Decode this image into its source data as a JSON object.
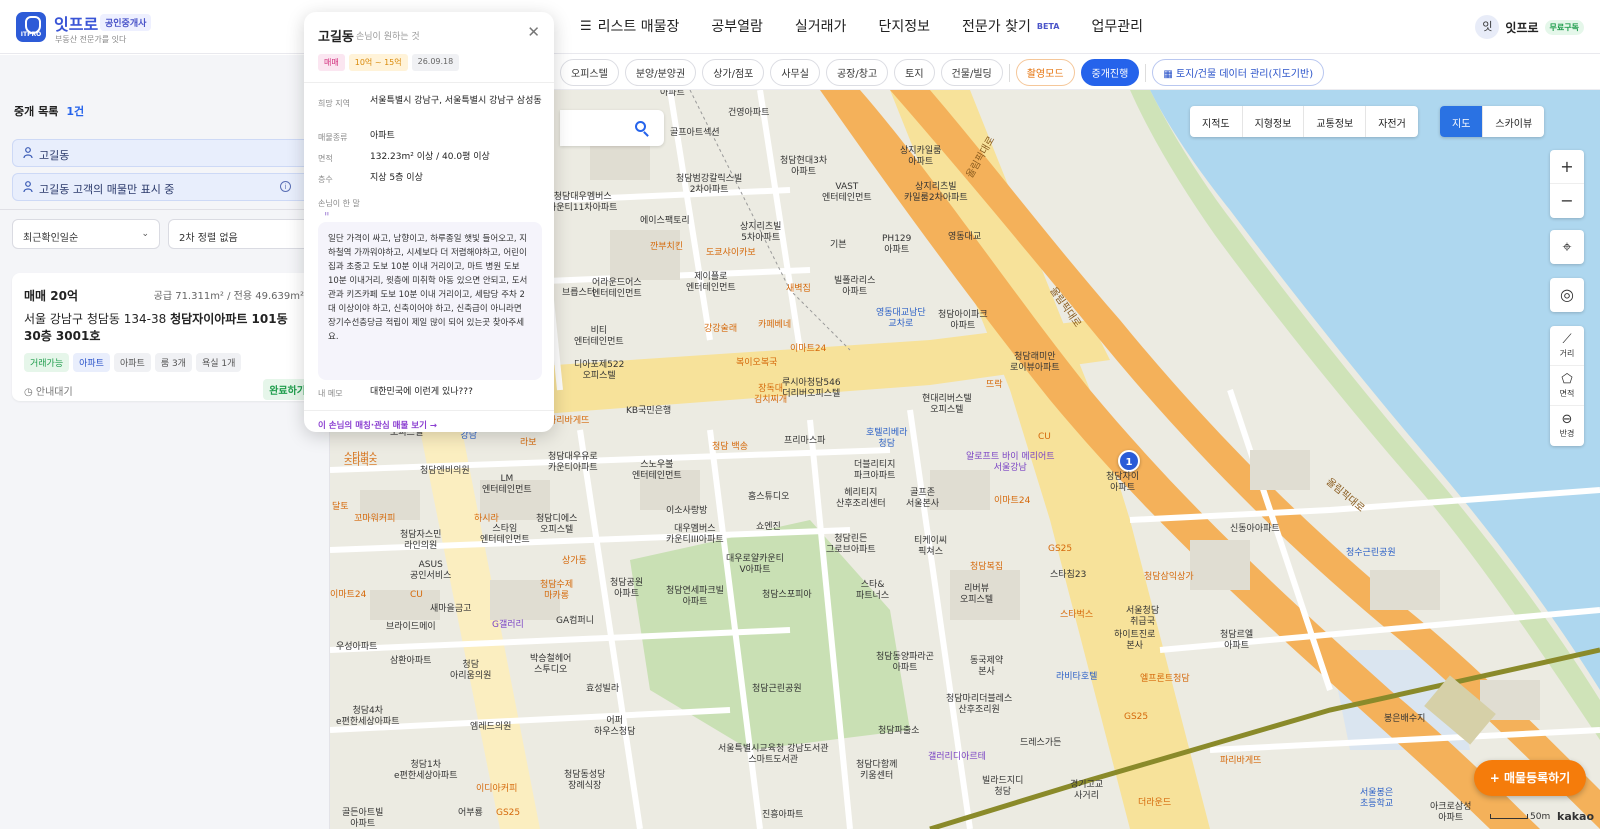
{
  "header": {
    "logo_text": "ITPRO",
    "brand": "잇프로",
    "brand_badge": "공인중개사",
    "tagline": "부동산 전문가를 잇다",
    "nav": [
      {
        "label": "리스트 매물장"
      },
      {
        "label": "공부열람"
      },
      {
        "label": "실거래가"
      },
      {
        "label": "단지정보"
      },
      {
        "label": "전문가 찾기",
        "badge": "BETA"
      },
      {
        "label": "업무관리"
      }
    ],
    "user_avatar": "잇",
    "user_name": "잇프로",
    "plan": "무료구독"
  },
  "filters": {
    "chips": [
      "오피스텔",
      "분양/분양권",
      "상가/점포",
      "사무실",
      "공장/창고",
      "토지",
      "건물/빌딩"
    ],
    "mode_chip": "촬영모드",
    "active_chip": "중개진행",
    "data_chip": "토지/건물 데이터 관리(지도기반)"
  },
  "left_panel": {
    "title": "중개 목록",
    "count": "1건",
    "search_value": "고길동",
    "filter_notice": "고길동 고객의 매물만 표시 중",
    "sort_primary": "최근확인일순",
    "sort_secondary": "2차 정렬 없음",
    "listing": {
      "price": "매매 20억",
      "area": "공급 71.311m² / 전용 49.639m²",
      "address_prefix": "서울 강남구 청담동 134-38 ",
      "address_bold": "청담자이아파트 101동 30층 3001호",
      "tags": [
        "거래가능",
        "아파트",
        "아파트",
        "룸 3개",
        "욕실 1개"
      ],
      "status": "안내대기",
      "done_label": "완료하기"
    }
  },
  "popup": {
    "name": "고길동",
    "subtitle": "손님이 원하는 것",
    "tags": [
      "매매",
      "10억 ~ 15억",
      "26.09.18"
    ],
    "rows": [
      {
        "label": "희망 지역",
        "value": "서울특별시 강남구, 서울특별시 강남구 삼성동"
      },
      {
        "label": "매물종류",
        "value": "아파트"
      },
      {
        "label": "면적",
        "value": "132.23m² 이상 / 40.0평 이상"
      },
      {
        "label": "층수",
        "value": "지상 5층 이상"
      }
    ],
    "note_label": "손님이 한 말",
    "note": "일단 가격이 싸고, 남향이고, 하루종일 햇빛 들어오고, 지하철역 가까워야하고, 시세보다 더 저렴해야하고, 어린이집과 초중고 도보 10분 이내 거리이고, 마트 병원 도보 10분 이내거리, 윗층에 미취학 아동 있으면 안되고, 도서관과 키즈카페 도보 10분 이내 거리이고, 세탐당 주차 2대 이상이야 하고, 신축이어야 하고, 신축급이 아니라면 장기수선충당금 적립이 제일 많이 되어 있는곳 찾아주세요.",
    "memo_label": "내 메모",
    "memo": "대한민국에 이런게 있나???",
    "link": "이 손님의 매칭·관심 매물 보기 →"
  },
  "map": {
    "layer_buttons": [
      "지적도",
      "지형정보",
      "교통정보",
      "자전거"
    ],
    "view_buttons": [
      "지도",
      "스카이뷰"
    ],
    "active_view": "지도",
    "zoom_in": "+",
    "zoom_out": "−",
    "tools": [
      "거리",
      "면적",
      "반경"
    ],
    "marker_count": "1",
    "marker_label": "청담자이\n아파트",
    "register_button": "+ 매물등록하기",
    "scale": "50m",
    "attribution": "kakao",
    "labels": [
      {
        "t": "아파트"
      },
      {
        "t": "건영아파트"
      },
      {
        "t": "골프아트섹션"
      },
      {
        "t": "청담현대3차\n아파트"
      },
      {
        "t": "상지카일룸\n아파트"
      },
      {
        "t": "청담대우멤버스\n카운티11차아파트"
      },
      {
        "t": "청담범강칼릭스빌\n2차아파트"
      },
      {
        "t": "VAST\n엔터테인먼트"
      },
      {
        "t": "상지리츠빌\n카일룸2차아파트"
      },
      {
        "t": "에이스팩토리"
      },
      {
        "t": "상지리츠빌\n5차아파트"
      },
      {
        "t": "깐부치킨"
      },
      {
        "t": "도쿄샤이카보"
      },
      {
        "t": "기븐"
      },
      {
        "t": "PH129\n아파트"
      },
      {
        "t": "제이플로\n엔터테인먼트"
      },
      {
        "t": "빌폴라리스\n아파트"
      },
      {
        "t": "새벽집"
      },
      {
        "t": "어라운드어스\n엔터테인먼트"
      },
      {
        "t": "브릅스터"
      },
      {
        "t": "비티\n엔터테인먼트"
      },
      {
        "t": "강강술래"
      },
      {
        "t": "카페베네"
      },
      {
        "t": "청담아이파크\n아파트"
      },
      {
        "t": "영동대교남단\n교차로"
      },
      {
        "t": "디아포제522\n오피스텔"
      },
      {
        "t": "복이오복국"
      },
      {
        "t": "이마트24"
      },
      {
        "t": "청담래미안\n로이뷰아파트"
      },
      {
        "t": "루시아청담546\n더리버오피스텔"
      },
      {
        "t": "장독대\n김치찌개"
      },
      {
        "t": "현대리버스텔\n오피스텔"
      },
      {
        "t": "뜨락"
      },
      {
        "t": "KB국민은행"
      },
      {
        "t": "파리바게뜨"
      },
      {
        "t": "프리마스파"
      },
      {
        "t": "청담 백송"
      },
      {
        "t": "호텔리베라\n청담"
      },
      {
        "t": "알로프트 바이 메리어트\n서울강남"
      },
      {
        "t": "CU"
      },
      {
        "t": "청담대우유로\n카운티아파트"
      },
      {
        "t": "스노우볼\n엔터테인먼트"
      },
      {
        "t": "청담엔비의원"
      },
      {
        "t": "LM\n엔터테인먼트"
      },
      {
        "t": "더블리티지\n파크아파트"
      },
      {
        "t": "홈스튜디오"
      },
      {
        "t": "헤리티지\n산후조리센터"
      },
      {
        "t": "골프존\n서울본사"
      },
      {
        "t": "이마트24"
      },
      {
        "t": "스타벅스"
      },
      {
        "t": "꼬마워커피"
      },
      {
        "t": "하시라"
      },
      {
        "t": "이소사랑방"
      },
      {
        "t": "청담디에스\n오피스텔"
      },
      {
        "t": "대우멤버스\n카운티III아파트"
      },
      {
        "t": "쇼엔진"
      },
      {
        "t": "티케이씨\n픽쳐스"
      },
      {
        "t": "청담자스민\n라인의원"
      },
      {
        "t": "스타임\n엔터테인먼트"
      },
      {
        "t": "대우로얄카운티\nV아파트"
      },
      {
        "t": "청담린든\n그로브아파트"
      },
      {
        "t": "GS25"
      },
      {
        "t": "청담복집"
      },
      {
        "t": "스타&\n파트너스"
      },
      {
        "t": "ASUS\n공인서비스"
      },
      {
        "t": "상가동"
      },
      {
        "t": "청담공원\n아파트"
      },
      {
        "t": "청담연세파크빌\n아파트"
      },
      {
        "t": "청담스포피아"
      },
      {
        "t": "스타침23"
      },
      {
        "t": "청담삼익상가"
      },
      {
        "t": "리버뷰\n오피스텔"
      },
      {
        "t": "스타벅스"
      },
      {
        "t": "청담수제\n마카롱"
      },
      {
        "t": "CU"
      },
      {
        "t": "새마을금고"
      },
      {
        "t": "GA컴퍼니"
      },
      {
        "t": "서울청담\n취급국"
      },
      {
        "t": "브라이드메이"
      },
      {
        "t": "G갤러리"
      },
      {
        "t": "하이트진로\n본사"
      },
      {
        "t": "청담르엘\n아파트"
      },
      {
        "t": "우성아파트"
      },
      {
        "t": "삼환아파트"
      },
      {
        "t": "청담\n아리움의원"
      },
      {
        "t": "박승철헤어\n스투디오"
      },
      {
        "t": "청담동양파라곤\n아파트"
      },
      {
        "t": "동국제약\n본사"
      },
      {
        "t": "라비타호텔"
      },
      {
        "t": "엘프론트청담"
      },
      {
        "t": "효성빌라"
      },
      {
        "t": "청담근린공원"
      },
      {
        "t": "청담4차\ne편한세상아파트"
      },
      {
        "t": "엠레드의원"
      },
      {
        "t": "어퍼\n하우스청담"
      },
      {
        "t": "청담마리더블레스\n산후조리원"
      },
      {
        "t": "GS25"
      },
      {
        "t": "청담파출소"
      },
      {
        "t": "드레스가든"
      },
      {
        "t": "청담1차\ne편한세상아파트"
      },
      {
        "t": "서울특별시교육청 강남도서관\n스마트도서관"
      },
      {
        "t": "청담다함께\n키움센터"
      },
      {
        "t": "갤러리디아르테"
      },
      {
        "t": "이디아커피"
      },
      {
        "t": "청담동성당\n장례식장"
      },
      {
        "t": "빌라드지디\n청담"
      },
      {
        "t": "경기고교\n사거리"
      },
      {
        "t": "더라운드"
      },
      {
        "t": "파리바게뜨"
      },
      {
        "t": "골든아트빌\n아파트"
      },
      {
        "t": "어부룡"
      },
      {
        "t": "GS25"
      },
      {
        "t": "진흥아파트"
      },
      {
        "t": "봉은배수지"
      },
      {
        "t": "신동아아파트"
      },
      {
        "t": "청수근린공원"
      },
      {
        "t": "서울봉은\n초등학교"
      },
      {
        "t": "아크로삼성\n아파트"
      },
      {
        "t": "영동대교"
      },
      {
        "t": "올림픽대로"
      },
      {
        "t": "올림픽대로"
      },
      {
        "t": "올림픽대로"
      },
      {
        "t": "호텔엔트라\n강남"
      },
      {
        "t": "라보"
      },
      {
        "t": "스타벅스"
      },
      {
        "t": "달토"
      },
      {
        "t": "이마트24"
      },
      {
        "t": "오피스텔"
      }
    ]
  }
}
